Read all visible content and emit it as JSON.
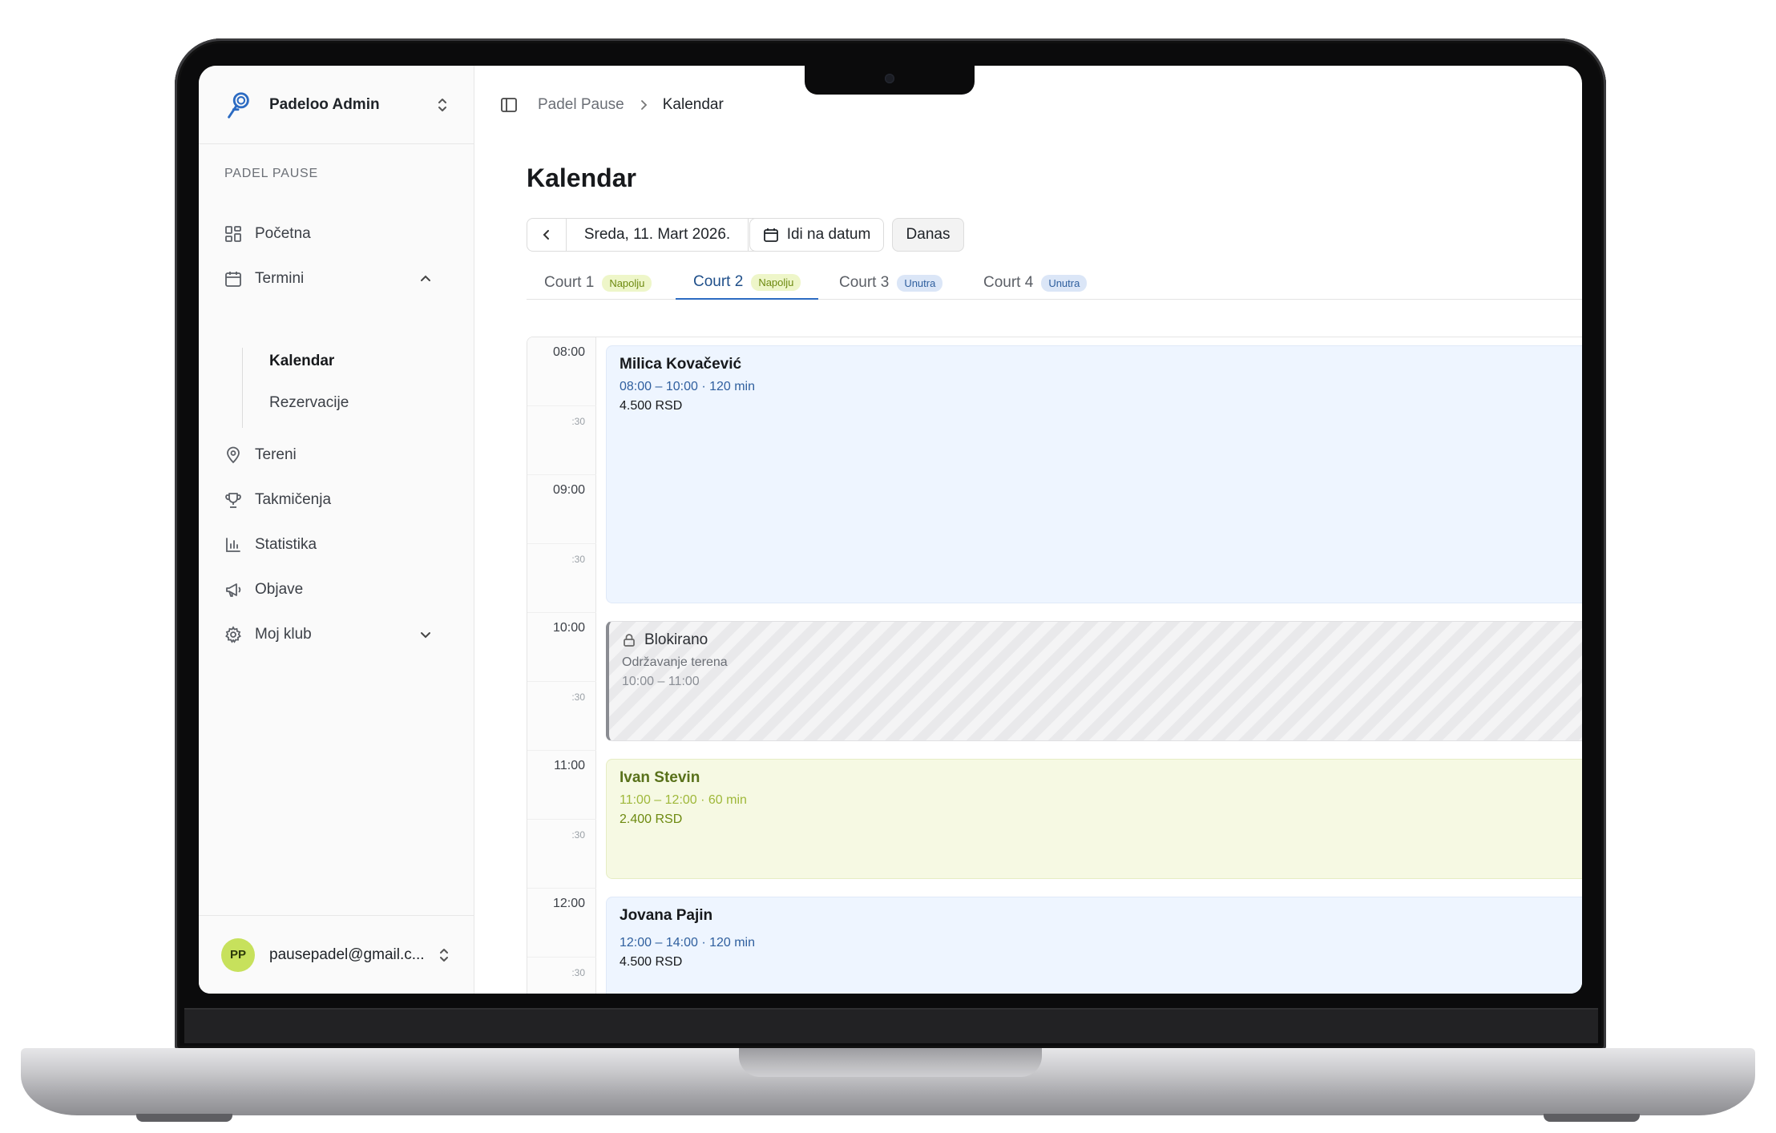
{
  "sidebar": {
    "app_name": "Padeloo Admin",
    "section_label": "PADEL PAUSE",
    "items": [
      {
        "label": "Početna"
      },
      {
        "label": "Termini"
      },
      {
        "label": "Tereni"
      },
      {
        "label": "Takmičenja"
      },
      {
        "label": "Statistika"
      },
      {
        "label": "Objave"
      },
      {
        "label": "Moj klub"
      }
    ],
    "sub_items": [
      {
        "label": "Kalendar"
      },
      {
        "label": "Rezervacije"
      }
    ],
    "user": {
      "initials": "PP",
      "email": "pausepadel@gmail.c..."
    }
  },
  "topbar": {
    "breadcrumb": [
      "Padel Pause",
      "Kalendar"
    ]
  },
  "page": {
    "title": "Kalendar",
    "date_label": "Sreda, 11. Mart 2026.",
    "goto_label": "Idi na datum",
    "today_label": "Danas"
  },
  "tabs": [
    {
      "label": "Court 1",
      "badge": "Napolju"
    },
    {
      "label": "Court 2",
      "badge": "Napolju"
    },
    {
      "label": "Court 3",
      "badge": "Unutra"
    },
    {
      "label": "Court 4",
      "badge": "Unutra"
    }
  ],
  "active_tab": "Court 2",
  "time_slots": [
    "08:00",
    ":30",
    "09:00",
    ":30",
    "10:00",
    ":30",
    "11:00",
    ":30",
    "12:00",
    ":30"
  ],
  "events": [
    {
      "name": "Milica Kovačević",
      "time": "08:00 – 10:00 · 120 min",
      "price": "4.500 RSD",
      "type": "booking"
    },
    {
      "name": "Blokirano",
      "note": "Održavanje terena",
      "time": "10:00 – 11:00",
      "type": "blocked"
    },
    {
      "name": "Ivan Stevin",
      "time": "11:00 – 12:00 · 60 min",
      "price": "2.400 RSD",
      "type": "booking-outdoor"
    },
    {
      "name": "Jovana Pajin",
      "time": "12:00 – 14:00 · 120 min",
      "price": "4.500 RSD",
      "type": "booking"
    }
  ],
  "colors": {
    "accent": "#2c6bc2",
    "avatar": "#c7e15c",
    "booking_bg": "#eef5ff",
    "outdoor_bg": "#f6f9e3"
  }
}
